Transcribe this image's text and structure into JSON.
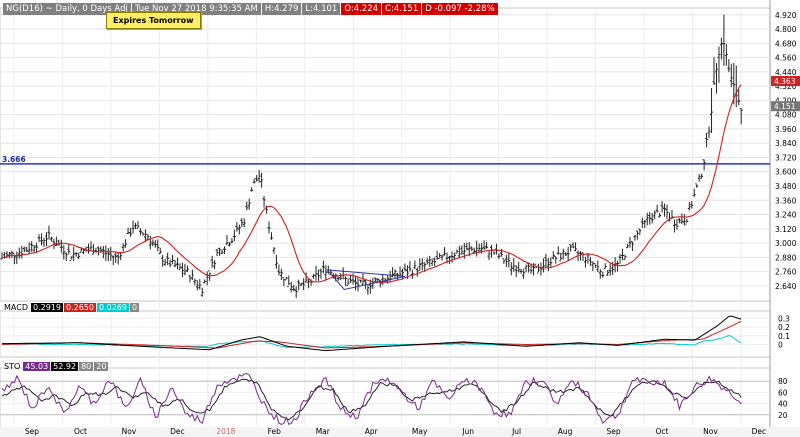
{
  "header": {
    "symbol": "NG(D16) ~ Daily, 0 Days Adj",
    "datetime": "Tue Nov 27 2018 9:35:35 AM",
    "high": "H:4.279",
    "low": "L:4.101",
    "open": "O:4.224",
    "close": "C:4.151",
    "change": "D -0.097 -2.28%"
  },
  "button": {
    "label": "Expires Tomorrow"
  },
  "colors": {
    "price_bars": "#222222",
    "ma_line": "#cc2222",
    "hline": "#2233cc",
    "trend": "#3333aa",
    "macd": "#000000",
    "signal": "#cc2222",
    "histogram": "#00cccc",
    "k_line": "#7a2a8a",
    "d_line": "#111111"
  },
  "chart_data": {
    "type": "candlestick",
    "title": "NG(D16) ~ Daily, 0 Days Adj",
    "x_axis": {
      "labels": [
        "Sep",
        "Oct",
        "Nov",
        "Dec",
        "2018",
        "Feb",
        "Mar",
        "Apr",
        "May",
        "Jun",
        "Jul",
        "Aug",
        "Sep",
        "Oct",
        "Nov",
        "Dec"
      ]
    },
    "price_axis": {
      "range": [
        2.53,
        4.96
      ],
      "ticks": [
        "4.920",
        "4.800",
        "4.680",
        "4.560",
        "4.440",
        "4.320",
        "4.200",
        "4.080",
        "3.960",
        "3.840",
        "3.720",
        "3.600",
        "3.480",
        "3.360",
        "3.240",
        "3.120",
        "3.000",
        "2.880",
        "2.760",
        "2.640"
      ],
      "last_price_tag": "4.363",
      "last_close_tag": "4.151"
    },
    "horizontal_line": {
      "value": 3.666,
      "label": "3.666"
    },
    "price_anchors": [
      {
        "t": 0,
        "v": 2.88
      },
      {
        "t": 0.03,
        "v": 2.94
      },
      {
        "t": 0.06,
        "v": 3.06
      },
      {
        "t": 0.09,
        "v": 2.9
      },
      {
        "t": 0.12,
        "v": 2.96
      },
      {
        "t": 0.15,
        "v": 2.87
      },
      {
        "t": 0.17,
        "v": 3.14
      },
      {
        "t": 0.19,
        "v": 3.06
      },
      {
        "t": 0.21,
        "v": 2.86
      },
      {
        "t": 0.24,
        "v": 2.76
      },
      {
        "t": 0.26,
        "v": 2.62
      },
      {
        "t": 0.28,
        "v": 2.92
      },
      {
        "t": 0.3,
        "v": 3.05
      },
      {
        "t": 0.315,
        "v": 3.2
      },
      {
        "t": 0.325,
        "v": 3.47
      },
      {
        "t": 0.335,
        "v": 3.58
      },
      {
        "t": 0.345,
        "v": 3.2
      },
      {
        "t": 0.36,
        "v": 2.76
      },
      {
        "t": 0.38,
        "v": 2.62
      },
      {
        "t": 0.4,
        "v": 2.67
      },
      {
        "t": 0.42,
        "v": 2.79
      },
      {
        "t": 0.45,
        "v": 2.68
      },
      {
        "t": 0.47,
        "v": 2.64
      },
      {
        "t": 0.5,
        "v": 2.71
      },
      {
        "t": 0.53,
        "v": 2.77
      },
      {
        "t": 0.56,
        "v": 2.84
      },
      {
        "t": 0.59,
        "v": 2.92
      },
      {
        "t": 0.62,
        "v": 2.96
      },
      {
        "t": 0.64,
        "v": 2.92
      },
      {
        "t": 0.66,
        "v": 2.82
      },
      {
        "t": 0.69,
        "v": 2.76
      },
      {
        "t": 0.71,
        "v": 2.85
      },
      {
        "t": 0.74,
        "v": 2.94
      },
      {
        "t": 0.76,
        "v": 2.87
      },
      {
        "t": 0.78,
        "v": 2.76
      },
      {
        "t": 0.8,
        "v": 2.82
      },
      {
        "t": 0.82,
        "v": 3.03
      },
      {
        "t": 0.84,
        "v": 3.21
      },
      {
        "t": 0.86,
        "v": 3.28
      },
      {
        "t": 0.875,
        "v": 3.17
      },
      {
        "t": 0.89,
        "v": 3.22
      },
      {
        "t": 0.9,
        "v": 3.42
      },
      {
        "t": 0.91,
        "v": 3.62
      },
      {
        "t": 0.92,
        "v": 4.05
      },
      {
        "t": 0.93,
        "v": 4.6
      },
      {
        "t": 0.937,
        "v": 4.72
      },
      {
        "t": 0.942,
        "v": 4.52
      },
      {
        "t": 0.948,
        "v": 4.35
      },
      {
        "t": 0.955,
        "v": 4.23
      },
      {
        "t": 0.96,
        "v": 4.15
      }
    ],
    "trend_triangle": [
      {
        "t": 0.425,
        "v": 2.775
      },
      {
        "t": 0.526,
        "v": 2.72
      },
      {
        "t": 0.447,
        "v": 2.61
      }
    ],
    "macd": {
      "label": "MACD",
      "values": [
        "0.2919",
        "0.2650",
        "0.0269",
        "0"
      ],
      "ticks": [
        "0.3",
        "0.2",
        "0.1",
        "0"
      ],
      "range": [
        -0.12,
        0.36
      ],
      "macd_anchors": [
        {
          "t": 0,
          "v": 0.01
        },
        {
          "t": 0.1,
          "v": 0.02
        },
        {
          "t": 0.2,
          "v": -0.03
        },
        {
          "t": 0.27,
          "v": -0.06
        },
        {
          "t": 0.31,
          "v": 0.05
        },
        {
          "t": 0.335,
          "v": 0.09
        },
        {
          "t": 0.37,
          "v": -0.02
        },
        {
          "t": 0.42,
          "v": -0.07
        },
        {
          "t": 0.5,
          "v": -0.02
        },
        {
          "t": 0.6,
          "v": 0.03
        },
        {
          "t": 0.68,
          "v": -0.02
        },
        {
          "t": 0.75,
          "v": 0.02
        },
        {
          "t": 0.8,
          "v": -0.01
        },
        {
          "t": 0.86,
          "v": 0.06
        },
        {
          "t": 0.9,
          "v": 0.05
        },
        {
          "t": 0.93,
          "v": 0.22
        },
        {
          "t": 0.945,
          "v": 0.33
        },
        {
          "t": 0.96,
          "v": 0.29
        }
      ],
      "signal_anchors": [
        {
          "t": 0,
          "v": 0.0
        },
        {
          "t": 0.1,
          "v": 0.02
        },
        {
          "t": 0.2,
          "v": -0.01
        },
        {
          "t": 0.28,
          "v": -0.04
        },
        {
          "t": 0.33,
          "v": 0.04
        },
        {
          "t": 0.36,
          "v": 0.03
        },
        {
          "t": 0.42,
          "v": -0.04
        },
        {
          "t": 0.5,
          "v": -0.02
        },
        {
          "t": 0.6,
          "v": 0.02
        },
        {
          "t": 0.68,
          "v": 0.0
        },
        {
          "t": 0.75,
          "v": 0.01
        },
        {
          "t": 0.8,
          "v": 0.0
        },
        {
          "t": 0.87,
          "v": 0.05
        },
        {
          "t": 0.91,
          "v": 0.06
        },
        {
          "t": 0.94,
          "v": 0.18
        },
        {
          "t": 0.96,
          "v": 0.265
        }
      ]
    },
    "stochastic": {
      "label": "STO",
      "values": [
        "45.03",
        "52.92",
        "80",
        "20"
      ],
      "ticks": [
        "80",
        "60",
        "40",
        "20"
      ],
      "range": [
        0,
        100
      ],
      "k_anchors": [
        {
          "t": 0,
          "v": 60
        },
        {
          "t": 0.02,
          "v": 85
        },
        {
          "t": 0.04,
          "v": 30
        },
        {
          "t": 0.06,
          "v": 75
        },
        {
          "t": 0.08,
          "v": 20
        },
        {
          "t": 0.1,
          "v": 70
        },
        {
          "t": 0.12,
          "v": 40
        },
        {
          "t": 0.14,
          "v": 85
        },
        {
          "t": 0.16,
          "v": 30
        },
        {
          "t": 0.18,
          "v": 80
        },
        {
          "t": 0.2,
          "v": 15
        },
        {
          "t": 0.22,
          "v": 70
        },
        {
          "t": 0.24,
          "v": 20
        },
        {
          "t": 0.26,
          "v": 10
        },
        {
          "t": 0.28,
          "v": 75
        },
        {
          "t": 0.3,
          "v": 85
        },
        {
          "t": 0.32,
          "v": 90
        },
        {
          "t": 0.34,
          "v": 40
        },
        {
          "t": 0.36,
          "v": 8
        },
        {
          "t": 0.38,
          "v": 10
        },
        {
          "t": 0.4,
          "v": 60
        },
        {
          "t": 0.42,
          "v": 85
        },
        {
          "t": 0.44,
          "v": 30
        },
        {
          "t": 0.46,
          "v": 15
        },
        {
          "t": 0.48,
          "v": 70
        },
        {
          "t": 0.5,
          "v": 85
        },
        {
          "t": 0.52,
          "v": 60
        },
        {
          "t": 0.54,
          "v": 30
        },
        {
          "t": 0.56,
          "v": 80
        },
        {
          "t": 0.58,
          "v": 45
        },
        {
          "t": 0.6,
          "v": 85
        },
        {
          "t": 0.62,
          "v": 70
        },
        {
          "t": 0.64,
          "v": 25
        },
        {
          "t": 0.66,
          "v": 20
        },
        {
          "t": 0.68,
          "v": 75
        },
        {
          "t": 0.7,
          "v": 85
        },
        {
          "t": 0.72,
          "v": 40
        },
        {
          "t": 0.74,
          "v": 80
        },
        {
          "t": 0.76,
          "v": 60
        },
        {
          "t": 0.78,
          "v": 10
        },
        {
          "t": 0.8,
          "v": 20
        },
        {
          "t": 0.82,
          "v": 85
        },
        {
          "t": 0.84,
          "v": 75
        },
        {
          "t": 0.86,
          "v": 80
        },
        {
          "t": 0.88,
          "v": 35
        },
        {
          "t": 0.9,
          "v": 70
        },
        {
          "t": 0.92,
          "v": 85
        },
        {
          "t": 0.94,
          "v": 65
        },
        {
          "t": 0.96,
          "v": 45
        }
      ],
      "d_anchors": [
        {
          "t": 0,
          "v": 55
        },
        {
          "t": 0.03,
          "v": 70
        },
        {
          "t": 0.05,
          "v": 45
        },
        {
          "t": 0.07,
          "v": 55
        },
        {
          "t": 0.09,
          "v": 35
        },
        {
          "t": 0.11,
          "v": 60
        },
        {
          "t": 0.13,
          "v": 55
        },
        {
          "t": 0.15,
          "v": 70
        },
        {
          "t": 0.17,
          "v": 50
        },
        {
          "t": 0.19,
          "v": 60
        },
        {
          "t": 0.21,
          "v": 35
        },
        {
          "t": 0.23,
          "v": 50
        },
        {
          "t": 0.25,
          "v": 22
        },
        {
          "t": 0.27,
          "v": 30
        },
        {
          "t": 0.29,
          "v": 70
        },
        {
          "t": 0.31,
          "v": 82
        },
        {
          "t": 0.33,
          "v": 80
        },
        {
          "t": 0.35,
          "v": 30
        },
        {
          "t": 0.37,
          "v": 12
        },
        {
          "t": 0.39,
          "v": 30
        },
        {
          "t": 0.41,
          "v": 70
        },
        {
          "t": 0.43,
          "v": 65
        },
        {
          "t": 0.45,
          "v": 25
        },
        {
          "t": 0.47,
          "v": 35
        },
        {
          "t": 0.49,
          "v": 75
        },
        {
          "t": 0.51,
          "v": 75
        },
        {
          "t": 0.53,
          "v": 45
        },
        {
          "t": 0.55,
          "v": 55
        },
        {
          "t": 0.57,
          "v": 60
        },
        {
          "t": 0.59,
          "v": 65
        },
        {
          "t": 0.61,
          "v": 78
        },
        {
          "t": 0.63,
          "v": 50
        },
        {
          "t": 0.65,
          "v": 25
        },
        {
          "t": 0.67,
          "v": 45
        },
        {
          "t": 0.69,
          "v": 78
        },
        {
          "t": 0.71,
          "v": 65
        },
        {
          "t": 0.73,
          "v": 60
        },
        {
          "t": 0.75,
          "v": 70
        },
        {
          "t": 0.77,
          "v": 35
        },
        {
          "t": 0.79,
          "v": 15
        },
        {
          "t": 0.81,
          "v": 50
        },
        {
          "t": 0.83,
          "v": 78
        },
        {
          "t": 0.85,
          "v": 78
        },
        {
          "t": 0.87,
          "v": 60
        },
        {
          "t": 0.89,
          "v": 50
        },
        {
          "t": 0.91,
          "v": 75
        },
        {
          "t": 0.93,
          "v": 78
        },
        {
          "t": 0.95,
          "v": 60
        },
        {
          "t": 0.96,
          "v": 53
        }
      ]
    }
  }
}
